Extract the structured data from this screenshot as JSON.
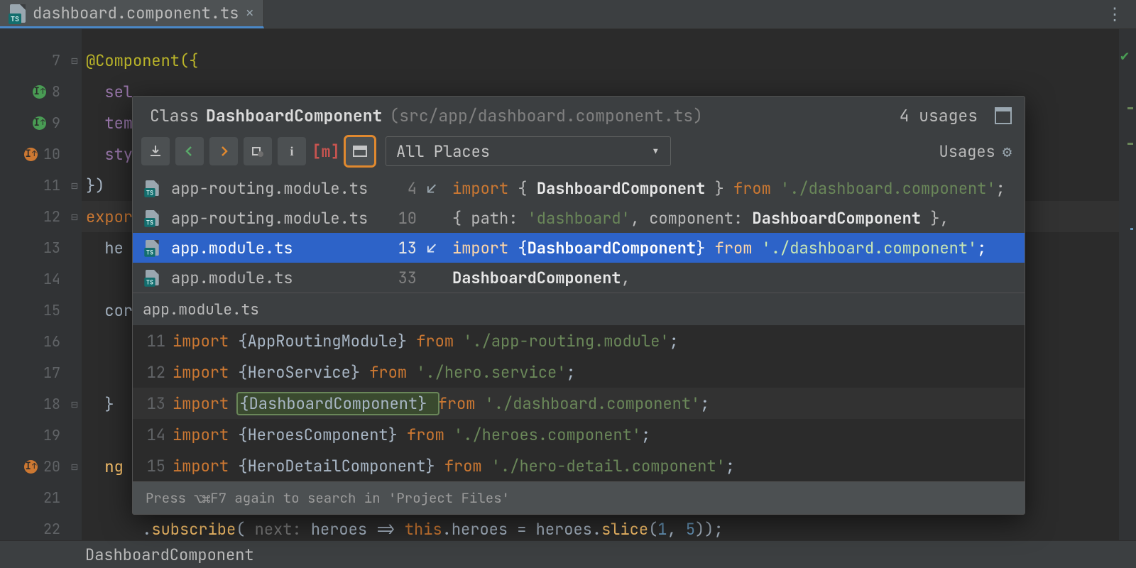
{
  "tab": {
    "filename": "dashboard.component.ts"
  },
  "gutter_lines": [
    {
      "n": 7,
      "hint": null
    },
    {
      "n": 8,
      "hint": "green"
    },
    {
      "n": 9,
      "hint": "green"
    },
    {
      "n": 10,
      "hint": "orange"
    },
    {
      "n": 11,
      "hint": null
    },
    {
      "n": 12,
      "hint": null
    },
    {
      "n": 13,
      "hint": null
    },
    {
      "n": 14,
      "hint": null
    },
    {
      "n": 15,
      "hint": null
    },
    {
      "n": 16,
      "hint": null
    },
    {
      "n": 17,
      "hint": null
    },
    {
      "n": 18,
      "hint": null
    },
    {
      "n": 19,
      "hint": null
    },
    {
      "n": 20,
      "hint": "orange"
    },
    {
      "n": 21,
      "hint": null
    },
    {
      "n": 22,
      "hint": null
    }
  ],
  "code_lines": {
    "7": "@Component({",
    "8": "  sel",
    "9": "  tem",
    "10": "  sty",
    "11": "})",
    "12": "export",
    "13": "  he",
    "15": "  cor",
    "18": "  }",
    "20": "  ng",
    "22_prefix": "      .",
    "22_fn": "subscribe",
    "22_hint": " next: ",
    "22_mid": "heroes => ",
    "22_this": "this",
    "22_tail1": ".heroes = heroes.",
    "22_slice": "slice",
    "22_open": "(",
    "22_n1": "1",
    "22_c": ", ",
    "22_n2": "5",
    "22_close": "));"
  },
  "popup": {
    "title_prefix": "Class",
    "title_name": "DashboardComponent",
    "title_path": "(src/app/dashboard.component.ts)",
    "usages_count": "4 usages",
    "scope": "All Places",
    "usages_label": "Usages"
  },
  "results": [
    {
      "file": "app-routing.module.ts",
      "line": "4",
      "icon": "↙",
      "kw": "import ",
      "p1": "{ ",
      "strong": "DashboardComponent",
      "p2": " } ",
      "kw2": "from ",
      "str": "'./dashboard.component'",
      "tail": ";"
    },
    {
      "file": "app-routing.module.ts",
      "line": "10",
      "icon": "",
      "kw": "",
      "p1": "{ path: ",
      "strong2": "",
      "str": "'dashboard'",
      "mid": ", component: ",
      "strong": "DashboardComponent",
      "p2": " },",
      "kw2": "",
      "tail": ""
    },
    {
      "file": "app.module.ts",
      "line": "13",
      "icon": "↙",
      "kw": "import ",
      "p1": "{",
      "strong": "DashboardComponent",
      "p2": "} ",
      "kw2": "from ",
      "str": "'./dashboard.component'",
      "tail": ";"
    },
    {
      "file": "app.module.ts",
      "line": "33",
      "icon": "",
      "kw": "",
      "p1": "",
      "strong": "DashboardComponent",
      "p2": ",",
      "kw2": "",
      "str": "",
      "tail": ""
    }
  ],
  "preview": {
    "file": "app.module.ts",
    "lines": [
      {
        "n": "11",
        "kw": "import ",
        "br": "{",
        "id": "AppRoutingModule",
        "br2": "} ",
        "kw2": "from ",
        "str": "'./app-routing.module'",
        "end": ";"
      },
      {
        "n": "12",
        "kw": "import ",
        "br": "{",
        "id": "HeroService",
        "br2": "} ",
        "kw2": "from ",
        "str": "'./hero.service'",
        "end": ";"
      },
      {
        "n": "13",
        "kw": "import ",
        "br": "{",
        "id": "DashboardComponent",
        "br2": "} ",
        "kw2": "from ",
        "str": "'./dashboard.component'",
        "end": ";"
      },
      {
        "n": "14",
        "kw": "import ",
        "br": "{",
        "id": "HeroesComponent",
        "br2": "} ",
        "kw2": "from ",
        "str": "'./heroes.component'",
        "end": ";"
      },
      {
        "n": "15",
        "kw": "import ",
        "br": "{",
        "id": "HeroDetailComponent",
        "br2": "} ",
        "kw2": "from ",
        "str": "'./hero-detail.component'",
        "end": ";"
      }
    ]
  },
  "hint": "Press ⌥⌘F7 again to search in 'Project Files'",
  "status": "DashboardComponent"
}
